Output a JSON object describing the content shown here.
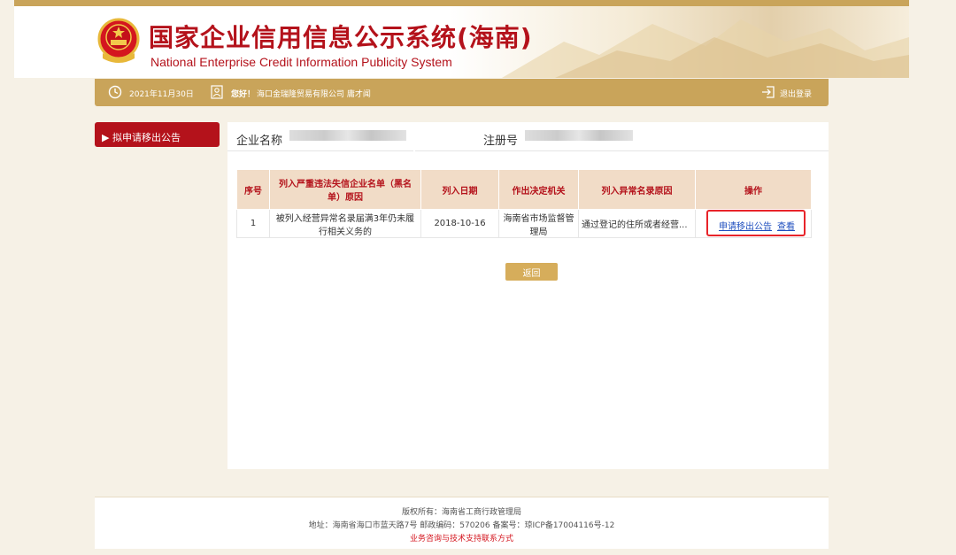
{
  "header": {
    "title_cn": "国家企业信用信息公示系统(海南)",
    "title_en": "National Enterprise Credit Information Publicity System"
  },
  "infobar": {
    "date": "2021年11月30日",
    "greeting": "您好！",
    "company": "海口金瑞隆贸易有限公司 庸才闻",
    "logout": "退出登录"
  },
  "sidebar": {
    "items": [
      {
        "label": "▶ 拟申请移出公告"
      }
    ]
  },
  "enterprise": {
    "name_label": "企业名称",
    "reg_label": "注册号"
  },
  "table": {
    "headers": [
      "序号",
      "列入严重违法失信企业名单（黑名单）原因",
      "列入日期",
      "作出决定机关",
      "列入异常名录原因",
      "操作"
    ],
    "rows": [
      {
        "index": "1",
        "reason": "被列入经营异常名录届满3年仍未履行相关义务的",
        "date": "2018-10-16",
        "authority": "海南省市场监督管理局",
        "abnormal_reason": "通过登记的住所或者经营...",
        "action_apply": "申请移出公告",
        "action_view": "查看"
      }
    ]
  },
  "back_button": "返回",
  "footer": {
    "copyright": "版权所有：海南省工商行政管理局",
    "address": "地址：海南省海口市蓝天路7号 邮政编码：570206 备案号：琼ICP备17004116号-12",
    "support_link": "业务咨询与技术支持联系方式"
  },
  "colors": {
    "brand_red": "#b4121b",
    "gold": "#c9a45a",
    "link_blue": "#1f4fbf",
    "highlight_red": "#e8242a"
  }
}
